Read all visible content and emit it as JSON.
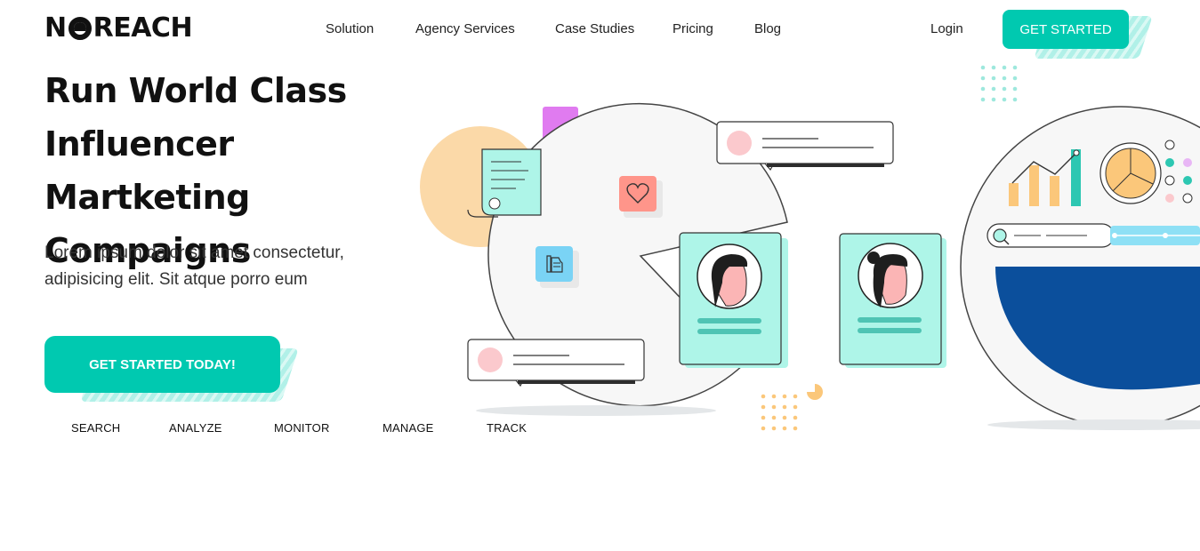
{
  "header": {
    "logo_left": "N",
    "logo_right": "REACH",
    "nav": [
      {
        "label": "Solution"
      },
      {
        "label": "Agency Services"
      },
      {
        "label": "Case Studies"
      },
      {
        "label": "Pricing"
      },
      {
        "label": "Blog"
      }
    ],
    "login_label": "Login",
    "cta_label": "GET STARTED"
  },
  "hero": {
    "title_line1": "Run World Class",
    "title_line2": "Influencer Martketing",
    "title_line3": "Compaigns",
    "subtitle_line1": "Lorem ipsum dolor sit amet consectetur,",
    "subtitle_line2": "adipisicing elit. Sit atque porro eum",
    "cta_label": "GET STARTED TODAY!"
  },
  "features": [
    {
      "label": "SEARCH"
    },
    {
      "label": "ANALYZE"
    },
    {
      "label": "MONITOR"
    },
    {
      "label": "MANAGE"
    },
    {
      "label": "TRACK"
    }
  ],
  "colors": {
    "accent": "#00c9b0",
    "mint": "#aef5e8",
    "navy": "#0b4f9c",
    "orange": "#fbc77a",
    "pink": "#fbc9cd",
    "purple": "#e07bf0"
  },
  "icons": [
    "heart-icon",
    "thumbs-up-icon",
    "search-icon",
    "pie-chart-icon",
    "bar-chart-icon",
    "document-icon"
  ]
}
